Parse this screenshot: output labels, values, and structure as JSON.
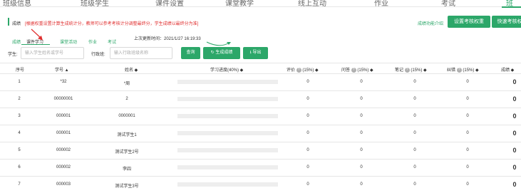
{
  "topnav": {
    "items": [
      "班级信息",
      "班级学生",
      "课件设置",
      "课堂教学",
      "线上互动",
      "作业",
      "考试",
      "班"
    ],
    "active_index": 7
  },
  "score_bar": {
    "title": "成绩",
    "notice": "[根据权重设置计算生成统计分，教师可以参考考核计分调整最终分，学生成绩以最终分为准]",
    "func_link": "成绩功能介绍",
    "set_weight_button": "设置考核权重",
    "quick_weight_button": "快速考核权"
  },
  "tabs": {
    "items": [
      "成绩",
      "课件学习",
      "课堂活动",
      "作业",
      "考试"
    ],
    "active_index": 1,
    "last_update": "上次更新时间：2021/1/27 16:19:33"
  },
  "filters": {
    "student_label": "学生:",
    "student_placeholder": "输入学生姓名或学号",
    "class_label": "行政班:",
    "class_placeholder": "输入行政班级名称",
    "query_button": "查询",
    "generate_button": "生成成绩",
    "export_button": "导出"
  },
  "table": {
    "headers": {
      "index": "序号",
      "student_no": "学号 ▲",
      "name": "姓名 ◆",
      "progress": "学习进度(40%) ◆",
      "comment": "评价",
      "comment_pct": "(15%) ◆",
      "question": "问答",
      "question_pct": "(15%) ◆",
      "notes": "笔记",
      "notes_pct": "(15%) ◆",
      "misc": "纠错",
      "misc_pct": "(15%) ◆",
      "score": "成绩 ◆",
      "help": "?"
    },
    "rows": [
      {
        "index": "1",
        "student_no": "*32",
        "name": "*周",
        "progress": 0,
        "comment": "0",
        "question": "0",
        "notes": "0",
        "misc": "0",
        "score": "0"
      },
      {
        "index": "2",
        "student_no": "00000001",
        "name": "2",
        "progress": 0,
        "comment": "0",
        "question": "0",
        "notes": "0",
        "misc": "0",
        "score": "0"
      },
      {
        "index": "3",
        "student_no": "000001",
        "name": "0000001",
        "progress": 0,
        "comment": "0",
        "question": "0",
        "notes": "0",
        "misc": "0",
        "score": "0"
      },
      {
        "index": "4",
        "student_no": "000001",
        "name": "测试学生1",
        "progress": 0,
        "comment": "0",
        "question": "0",
        "notes": "0",
        "misc": "0",
        "score": "0"
      },
      {
        "index": "5",
        "student_no": "000002",
        "name": "测试学生2号",
        "progress": 0,
        "comment": "0",
        "question": "0",
        "notes": "0",
        "misc": "0",
        "score": "0"
      },
      {
        "index": "6",
        "student_no": "000002",
        "name": "李四",
        "progress": 0,
        "comment": "0",
        "question": "0",
        "notes": "0",
        "misc": "0",
        "score": "0"
      },
      {
        "index": "7",
        "student_no": "000003",
        "name": "测试学生3号",
        "progress": 0,
        "comment": "0",
        "question": "0",
        "notes": "0",
        "misc": "0",
        "score": "0"
      }
    ]
  },
  "colors": {
    "accent": "#2ca769",
    "notice": "#e02f2f",
    "annotation_arrow": "#e02f2f"
  },
  "icons": {
    "generate": "refresh-icon",
    "export": "download-icon",
    "help": "help-circle-icon"
  }
}
